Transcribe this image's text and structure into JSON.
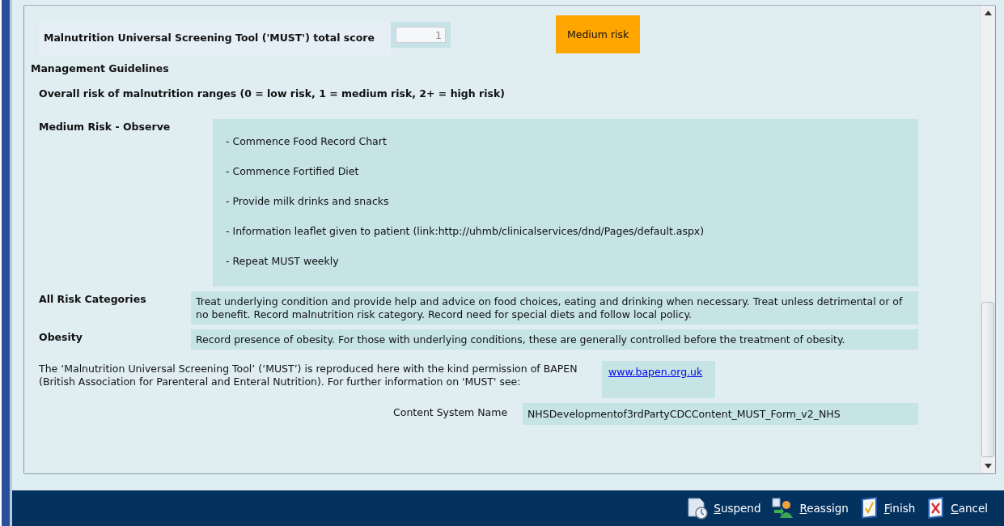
{
  "score": {
    "label": "Malnutrition Universal Screening Tool ('MUST') total score",
    "value": "1",
    "risk_badge": "Medium risk"
  },
  "management_heading": "Management Guidelines",
  "ranges_text": "Overall risk of malnutrition ranges (0 = low risk, 1 = medium risk, 2+ = high risk)",
  "guidelines": [
    {
      "label": "Medium Risk - Observe",
      "kind": "list",
      "lines": [
        "- Commence Food Record Chart",
        "- Commence Fortified Diet",
        "- Provide milk drinks and snacks",
        "- Information leaflet given to patient (link:http://uhmb/clinicalservices/dnd/Pages/default.aspx)",
        "- Repeat MUST weekly"
      ]
    },
    {
      "label": "All Risk Categories",
      "kind": "text",
      "text": "Treat underlying condition and provide help and advice on food choices, eating and drinking when necessary. Treat unless detrimental or of no benefit. Record malnutrition risk category. Record need for special diets and follow local policy."
    },
    {
      "label": "Obesity",
      "kind": "text",
      "text": "Record presence of obesity. For those with underlying conditions, these are generally controlled before the treatment of obesity."
    }
  ],
  "permission_text": "The ‘Malnutrition Universal Screening Tool’ (‘MUST’) is reproduced here with the kind permission of BAPEN (British Association for Parenteral and Enteral Nutrition). For further information on 'MUST' see:",
  "link": "www.bapen.org.uk",
  "content_system": {
    "label": "Content System Name",
    "value": "NHSDevelopmentof3rdPartyCDCContent_MUST_Form_v2_NHS"
  },
  "footer_buttons": [
    {
      "label": "Suspend",
      "kind": "suspend"
    },
    {
      "label": "Reassign",
      "kind": "reassign"
    },
    {
      "label": "Finish",
      "kind": "finish"
    },
    {
      "label": "Cancel",
      "kind": "cancel"
    }
  ]
}
